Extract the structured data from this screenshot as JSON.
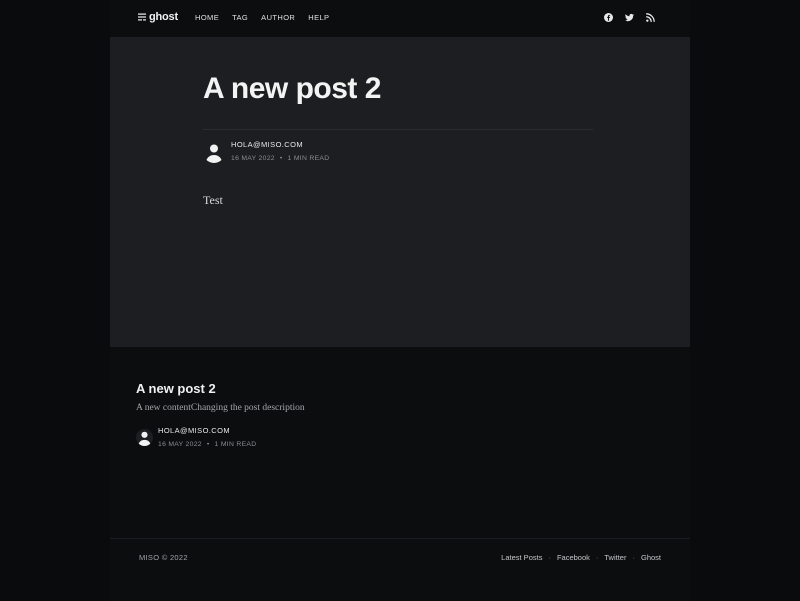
{
  "header": {
    "logo_text": "ghost",
    "nav": [
      {
        "label": "HOME"
      },
      {
        "label": "TAG"
      },
      {
        "label": "AUTHOR"
      },
      {
        "label": "HELP"
      }
    ],
    "social_icons": [
      "facebook-icon",
      "twitter-icon",
      "rss-icon"
    ]
  },
  "post": {
    "title": "A new post 2",
    "author": "HOLA@MISO.COM",
    "date": "16 MAY 2022",
    "separator": "•",
    "read_time": "1 MIN READ",
    "body": "Test"
  },
  "related": {
    "title": "A new post 2",
    "excerpt": "A new contentChanging the post description",
    "author": "HOLA@MISO.COM",
    "date": "16 MAY 2022",
    "separator": "•",
    "read_time": "1 MIN READ"
  },
  "footer": {
    "copyright": "MISO © 2022",
    "links": [
      {
        "label": "Latest Posts"
      },
      {
        "label": "Facebook"
      },
      {
        "label": "Twitter"
      },
      {
        "label": "Ghost"
      }
    ],
    "separator": "·"
  },
  "colors": {
    "outer_bg": "#0a0b0c",
    "header_bg": "#0c0d0f",
    "article_bg": "#1d1e22",
    "text": "#f3f3f3",
    "muted": "#8a8c92"
  }
}
